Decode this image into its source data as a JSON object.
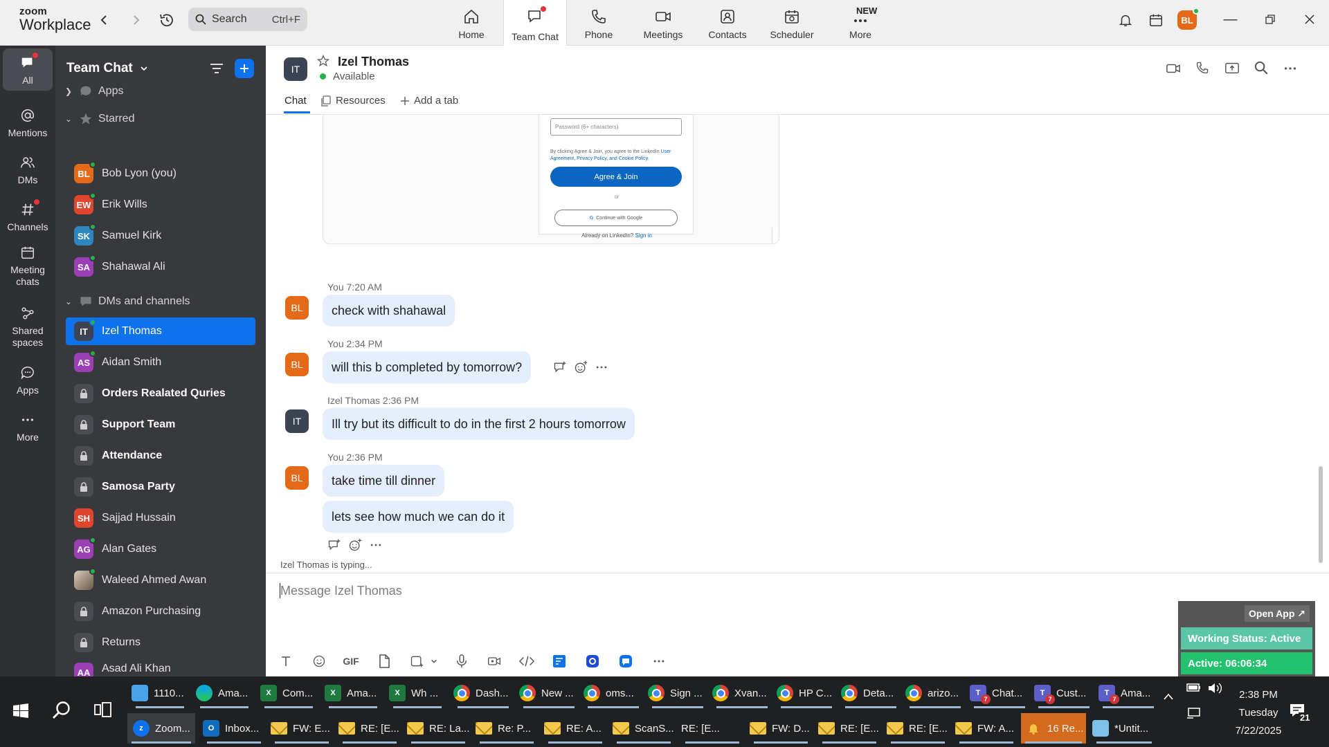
{
  "app": {
    "brand_line1": "zoom",
    "brand_line2": "Workplace"
  },
  "search": {
    "placeholder": "Search",
    "shortcut": "Ctrl+F"
  },
  "nav": {
    "tabs": [
      {
        "label": "Home"
      },
      {
        "label": "Team Chat"
      },
      {
        "label": "Phone"
      },
      {
        "label": "Meetings"
      },
      {
        "label": "Contacts"
      },
      {
        "label": "Scheduler"
      },
      {
        "label": "More",
        "badge": "NEW"
      }
    ],
    "profile_initials": "BL"
  },
  "rail": [
    {
      "label": "All"
    },
    {
      "label": "Mentions"
    },
    {
      "label": "DMs"
    },
    {
      "label": "Channels"
    },
    {
      "label": "Meeting chats"
    },
    {
      "label": "Shared spaces"
    },
    {
      "label": "Apps"
    },
    {
      "label": "More"
    }
  ],
  "sidebar": {
    "title": "Team Chat",
    "sections": {
      "apps": "Apps",
      "starred": "Starred",
      "dms": "DMs and channels"
    },
    "starred": [
      {
        "initials": "BL",
        "name": "Bob Lyon (you)",
        "color": "#e36a19"
      },
      {
        "initials": "EW",
        "name": "Erik Wills",
        "color": "#e0452e"
      },
      {
        "initials": "SK",
        "name": "Samuel Kirk",
        "color": "#2e86c1"
      },
      {
        "initials": "SA",
        "name": "Shahawal Ali",
        "color": "#9b3fb5"
      }
    ],
    "dms": [
      {
        "initials": "IT",
        "name": "Izel Thomas",
        "color": "#3c4454"
      },
      {
        "initials": "AS",
        "name": "Aidan Smith",
        "color": "#9b3fb5"
      },
      {
        "name": "Orders Realated Quries"
      },
      {
        "name": "Support Team"
      },
      {
        "name": "Attendance"
      },
      {
        "name": "Samosa Party"
      },
      {
        "initials": "SH",
        "name": "Sajjad Hussain",
        "color": "#e0452e"
      },
      {
        "initials": "AG",
        "name": "Alan Gates",
        "color": "#9b3fb5"
      },
      {
        "name": "Waleed Ahmed Awan"
      },
      {
        "name": "Amazon Purchasing"
      },
      {
        "name": "Returns"
      },
      {
        "initials": "AA",
        "name": "Asad Ali Khan",
        "color": "#9b3fb5"
      }
    ]
  },
  "chat": {
    "contact_initials": "IT",
    "contact_name": "Izel Thomas",
    "status": "Available",
    "tabs": {
      "chat": "Chat",
      "resources": "Resources",
      "add": "Add a tab"
    },
    "preview": {
      "password_placeholder": "Password (6+ characters)",
      "terms": "By clicking Agree & Join, you agree to the LinkedIn",
      "terms_links": "User Agreement, Privacy Policy, and Cookie Policy.",
      "agree": "Agree & Join",
      "or": "or",
      "google": "Continue with Google",
      "already": "Already on LinkedIn?",
      "signin": "Sign in"
    },
    "messages": [
      {
        "meta": "You 7:20 AM",
        "initials": "BL",
        "text": "check with shahawal"
      },
      {
        "meta": "You 2:34 PM",
        "initials": "BL",
        "text": "will this b completed by tomorrow?"
      },
      {
        "meta": "Izel Thomas 2:36 PM",
        "initials": "IT",
        "text": "Ill try but its difficult to do in the first 2 hours tomorrow"
      },
      {
        "meta": "You 2:36 PM",
        "initials": "BL",
        "text": "take time till dinner"
      },
      {
        "text": "lets see how much we can do it"
      }
    ],
    "typing": "Izel Thomas is typing...",
    "composer_placeholder": "Message Izel Thomas",
    "gif_label": "GIF"
  },
  "widget": {
    "open_app": "Open App ↗",
    "working_status": "Working Status: Active",
    "active_timer": "Active: 06:06:34"
  },
  "taskbar": {
    "row1": [
      {
        "label": "1110...",
        "icon": "files"
      },
      {
        "label": "Ama...",
        "icon": "edge"
      },
      {
        "label": "Com...",
        "icon": "excel"
      },
      {
        "label": "Ama...",
        "icon": "excel"
      },
      {
        "label": "Wh ...",
        "icon": "excel"
      },
      {
        "label": "Dash...",
        "icon": "chrome"
      },
      {
        "label": "New ...",
        "icon": "chrome"
      },
      {
        "label": "oms...",
        "icon": "chrome"
      },
      {
        "label": "Sign ...",
        "icon": "chrome"
      },
      {
        "label": "Xvan...",
        "icon": "chrome"
      },
      {
        "label": "HP C...",
        "icon": "chrome"
      },
      {
        "label": "Deta...",
        "icon": "chrome"
      },
      {
        "label": "arizo...",
        "icon": "chrome"
      },
      {
        "label": "Chat...",
        "icon": "teams",
        "badge": "7"
      },
      {
        "label": "Cust...",
        "icon": "teams",
        "badge": "7"
      },
      {
        "label": "Ama...",
        "icon": "teams",
        "badge": "7"
      }
    ],
    "row2": [
      {
        "label": "Zoom...",
        "icon": "zoom"
      },
      {
        "label": "Inbox...",
        "icon": "outlook"
      },
      {
        "label": "FW: E...",
        "icon": "mail"
      },
      {
        "label": "RE: [E...",
        "icon": "mail"
      },
      {
        "label": "RE: La...",
        "icon": "mail"
      },
      {
        "label": "Re: P...",
        "icon": "mail"
      },
      {
        "label": "RE: A...",
        "icon": "mail"
      },
      {
        "label": "ScanS...",
        "icon": "mail"
      },
      {
        "label": "RE: [E...",
        "icon": "none"
      },
      {
        "label": "FW: D...",
        "icon": "mail"
      },
      {
        "label": "RE: [E...",
        "icon": "mail"
      },
      {
        "label": "RE: [E...",
        "icon": "mail"
      },
      {
        "label": "FW: A...",
        "icon": "mail"
      },
      {
        "label": "16 Re...",
        "icon": "bell"
      },
      {
        "label": "*Untit...",
        "icon": "notepad"
      }
    ],
    "time": "2:38 PM",
    "day": "Tuesday",
    "date": "7/22/2025",
    "notifications": "21"
  }
}
